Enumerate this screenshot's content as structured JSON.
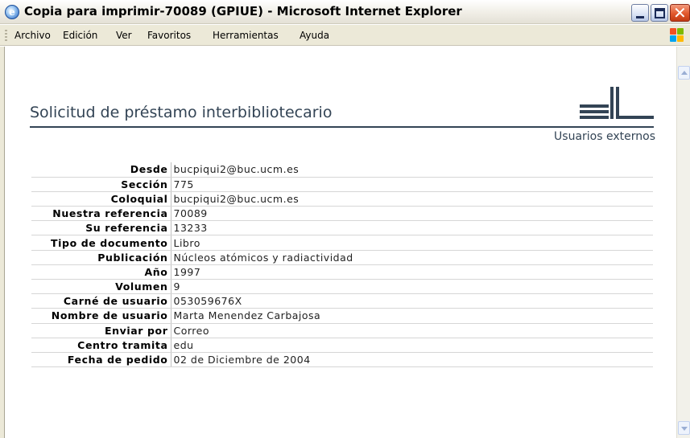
{
  "window": {
    "title": "Copia para imprimir-70089 (GPIUE) - Microsoft Internet Explorer"
  },
  "menu": {
    "items": [
      "Archivo",
      "Edición",
      "Ver",
      "Favoritos",
      "Herramientas",
      "Ayuda"
    ]
  },
  "page": {
    "title": "Solicitud de préstamo interbibliotecario",
    "subtitle": "Usuarios externos"
  },
  "details": {
    "rows": [
      {
        "label": "Desde",
        "value": "bucpiqui2@buc.ucm.es"
      },
      {
        "label": "Sección",
        "value": "775"
      },
      {
        "label": "Coloquial",
        "value": "bucpiqui2@buc.ucm.es"
      },
      {
        "label": "Nuestra referencia",
        "value": "70089"
      },
      {
        "label": "Su referencia",
        "value": "13233"
      },
      {
        "label": "Tipo de documento",
        "value": "Libro"
      },
      {
        "label": "Publicación",
        "value": "Núcleos atómicos y radiactividad"
      },
      {
        "label": "Año",
        "value": "1997"
      },
      {
        "label": "Volumen",
        "value": "9"
      },
      {
        "label": "Carné de usuario",
        "value": "053059676X"
      },
      {
        "label": "Nombre de usuario",
        "value": "Marta Menendez Carbajosa"
      },
      {
        "label": "Enviar por",
        "value": "Correo"
      },
      {
        "label": "Centro tramita",
        "value": "edu"
      },
      {
        "label": "Fecha de pedido",
        "value": "02 de Diciembre de 2004"
      }
    ]
  },
  "icons": {
    "app": "internet-explorer-icon",
    "minimize": "minimize-icon",
    "maximize": "maximize-icon",
    "close": "close-icon",
    "brand": "windows-logo-icon",
    "logo": "library-logo-icon"
  },
  "colors": {
    "title_text": "#334455",
    "menubar_bg": "#ece9d8",
    "close_button": "#e2582c"
  }
}
